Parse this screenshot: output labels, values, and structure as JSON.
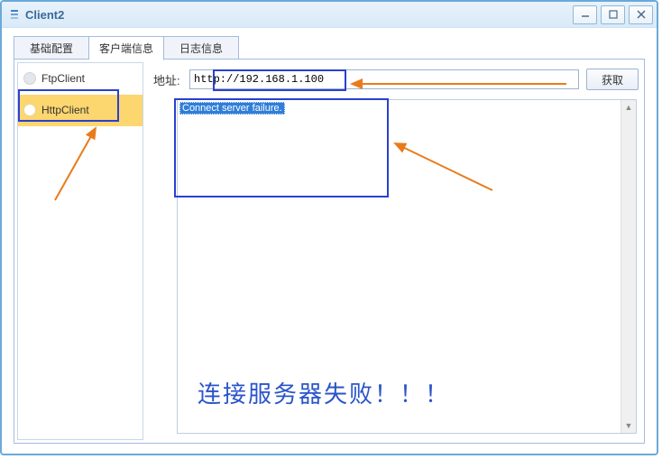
{
  "window": {
    "title": "Client2"
  },
  "tabs": [
    {
      "label": "基础配置"
    },
    {
      "label": "客户端信息"
    },
    {
      "label": "日志信息"
    }
  ],
  "sidebar": {
    "items": [
      {
        "label": "FtpClient"
      },
      {
        "label": "HttpClient"
      }
    ],
    "selected_index": 1
  },
  "address": {
    "label": "地址:",
    "value": "http://192.168.1.100",
    "fetch_button": "获取"
  },
  "output": {
    "selected_line": "Connect server failure."
  },
  "annotation": {
    "failure_cn": "连接服务器失败！！！"
  }
}
